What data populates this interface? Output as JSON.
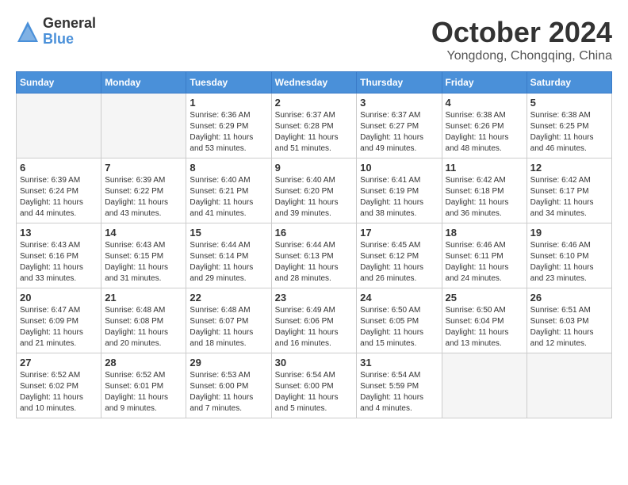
{
  "logo": {
    "general": "General",
    "blue": "Blue"
  },
  "title": "October 2024",
  "location": "Yongdong, Chongqing, China",
  "weekdays": [
    "Sunday",
    "Monday",
    "Tuesday",
    "Wednesday",
    "Thursday",
    "Friday",
    "Saturday"
  ],
  "weeks": [
    [
      {
        "day": "",
        "info": ""
      },
      {
        "day": "",
        "info": ""
      },
      {
        "day": "1",
        "info": "Sunrise: 6:36 AM\nSunset: 6:29 PM\nDaylight: 11 hours and 53 minutes."
      },
      {
        "day": "2",
        "info": "Sunrise: 6:37 AM\nSunset: 6:28 PM\nDaylight: 11 hours and 51 minutes."
      },
      {
        "day": "3",
        "info": "Sunrise: 6:37 AM\nSunset: 6:27 PM\nDaylight: 11 hours and 49 minutes."
      },
      {
        "day": "4",
        "info": "Sunrise: 6:38 AM\nSunset: 6:26 PM\nDaylight: 11 hours and 48 minutes."
      },
      {
        "day": "5",
        "info": "Sunrise: 6:38 AM\nSunset: 6:25 PM\nDaylight: 11 hours and 46 minutes."
      }
    ],
    [
      {
        "day": "6",
        "info": "Sunrise: 6:39 AM\nSunset: 6:24 PM\nDaylight: 11 hours and 44 minutes."
      },
      {
        "day": "7",
        "info": "Sunrise: 6:39 AM\nSunset: 6:22 PM\nDaylight: 11 hours and 43 minutes."
      },
      {
        "day": "8",
        "info": "Sunrise: 6:40 AM\nSunset: 6:21 PM\nDaylight: 11 hours and 41 minutes."
      },
      {
        "day": "9",
        "info": "Sunrise: 6:40 AM\nSunset: 6:20 PM\nDaylight: 11 hours and 39 minutes."
      },
      {
        "day": "10",
        "info": "Sunrise: 6:41 AM\nSunset: 6:19 PM\nDaylight: 11 hours and 38 minutes."
      },
      {
        "day": "11",
        "info": "Sunrise: 6:42 AM\nSunset: 6:18 PM\nDaylight: 11 hours and 36 minutes."
      },
      {
        "day": "12",
        "info": "Sunrise: 6:42 AM\nSunset: 6:17 PM\nDaylight: 11 hours and 34 minutes."
      }
    ],
    [
      {
        "day": "13",
        "info": "Sunrise: 6:43 AM\nSunset: 6:16 PM\nDaylight: 11 hours and 33 minutes."
      },
      {
        "day": "14",
        "info": "Sunrise: 6:43 AM\nSunset: 6:15 PM\nDaylight: 11 hours and 31 minutes."
      },
      {
        "day": "15",
        "info": "Sunrise: 6:44 AM\nSunset: 6:14 PM\nDaylight: 11 hours and 29 minutes."
      },
      {
        "day": "16",
        "info": "Sunrise: 6:44 AM\nSunset: 6:13 PM\nDaylight: 11 hours and 28 minutes."
      },
      {
        "day": "17",
        "info": "Sunrise: 6:45 AM\nSunset: 6:12 PM\nDaylight: 11 hours and 26 minutes."
      },
      {
        "day": "18",
        "info": "Sunrise: 6:46 AM\nSunset: 6:11 PM\nDaylight: 11 hours and 24 minutes."
      },
      {
        "day": "19",
        "info": "Sunrise: 6:46 AM\nSunset: 6:10 PM\nDaylight: 11 hours and 23 minutes."
      }
    ],
    [
      {
        "day": "20",
        "info": "Sunrise: 6:47 AM\nSunset: 6:09 PM\nDaylight: 11 hours and 21 minutes."
      },
      {
        "day": "21",
        "info": "Sunrise: 6:48 AM\nSunset: 6:08 PM\nDaylight: 11 hours and 20 minutes."
      },
      {
        "day": "22",
        "info": "Sunrise: 6:48 AM\nSunset: 6:07 PM\nDaylight: 11 hours and 18 minutes."
      },
      {
        "day": "23",
        "info": "Sunrise: 6:49 AM\nSunset: 6:06 PM\nDaylight: 11 hours and 16 minutes."
      },
      {
        "day": "24",
        "info": "Sunrise: 6:50 AM\nSunset: 6:05 PM\nDaylight: 11 hours and 15 minutes."
      },
      {
        "day": "25",
        "info": "Sunrise: 6:50 AM\nSunset: 6:04 PM\nDaylight: 11 hours and 13 minutes."
      },
      {
        "day": "26",
        "info": "Sunrise: 6:51 AM\nSunset: 6:03 PM\nDaylight: 11 hours and 12 minutes."
      }
    ],
    [
      {
        "day": "27",
        "info": "Sunrise: 6:52 AM\nSunset: 6:02 PM\nDaylight: 11 hours and 10 minutes."
      },
      {
        "day": "28",
        "info": "Sunrise: 6:52 AM\nSunset: 6:01 PM\nDaylight: 11 hours and 9 minutes."
      },
      {
        "day": "29",
        "info": "Sunrise: 6:53 AM\nSunset: 6:00 PM\nDaylight: 11 hours and 7 minutes."
      },
      {
        "day": "30",
        "info": "Sunrise: 6:54 AM\nSunset: 6:00 PM\nDaylight: 11 hours and 5 minutes."
      },
      {
        "day": "31",
        "info": "Sunrise: 6:54 AM\nSunset: 5:59 PM\nDaylight: 11 hours and 4 minutes."
      },
      {
        "day": "",
        "info": ""
      },
      {
        "day": "",
        "info": ""
      }
    ]
  ]
}
